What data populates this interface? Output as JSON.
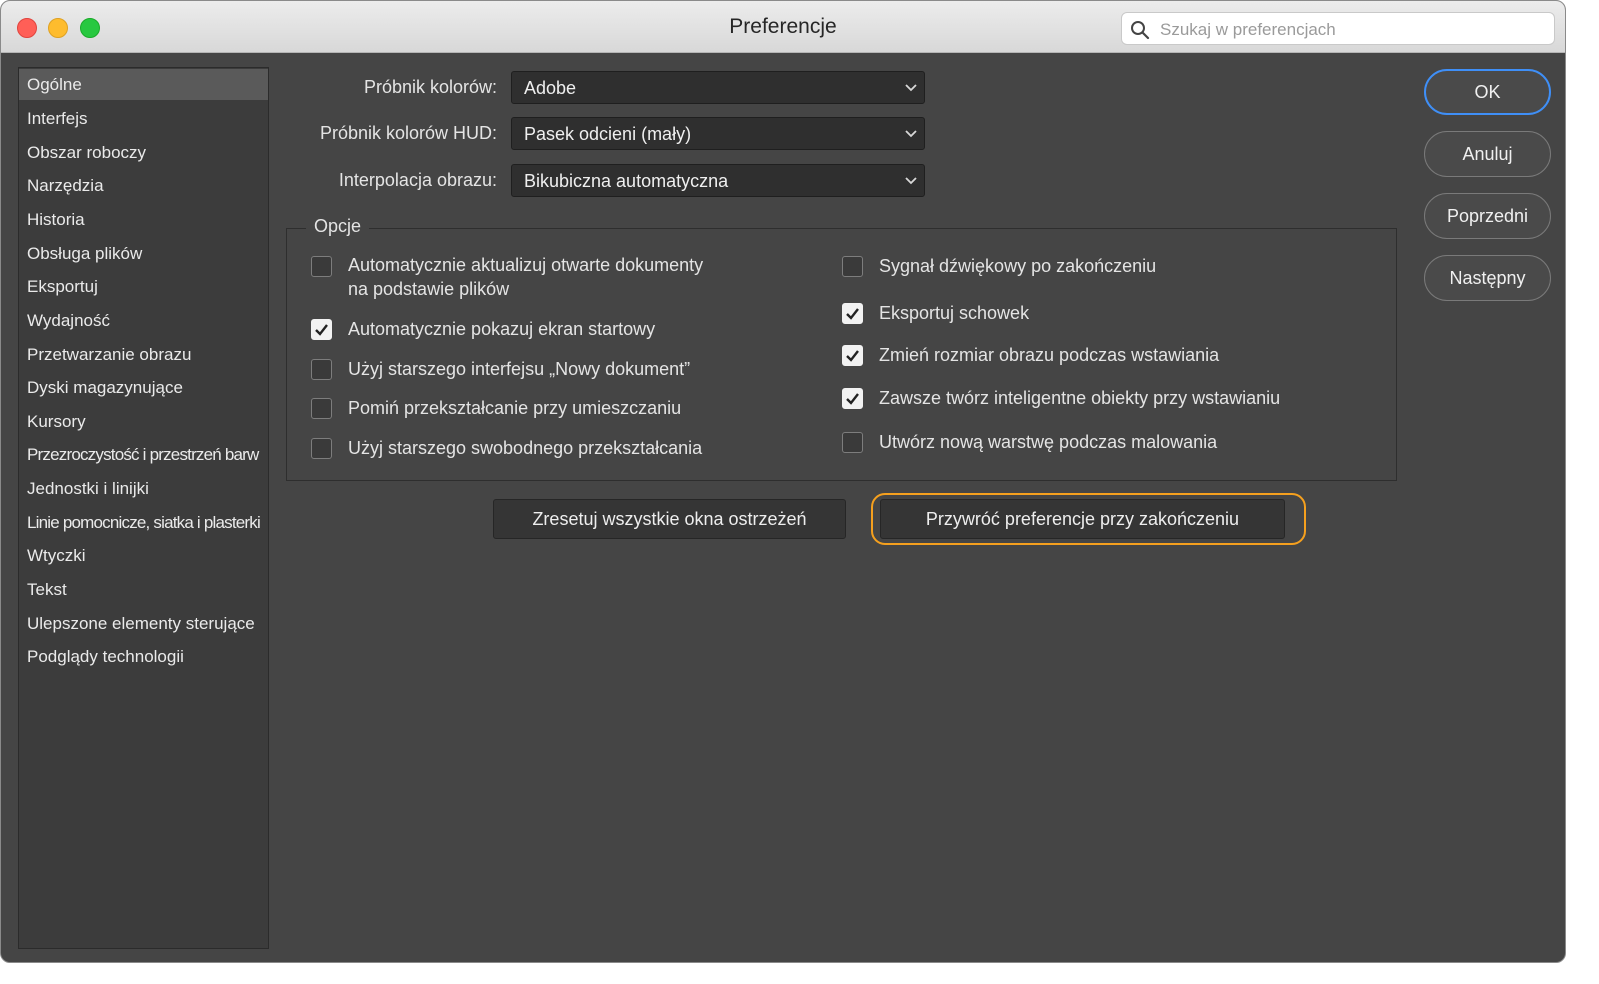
{
  "window": {
    "title": "Preferencje",
    "search": {
      "placeholder": "Szukaj w preferencjach",
      "value": ""
    }
  },
  "sidebar": {
    "items": [
      {
        "label": "Ogólne",
        "active": true
      },
      {
        "label": "Interfejs"
      },
      {
        "label": "Obszar roboczy"
      },
      {
        "label": "Narzędzia"
      },
      {
        "label": "Historia"
      },
      {
        "label": "Obsługa plików"
      },
      {
        "label": "Eksportuj"
      },
      {
        "label": "Wydajność"
      },
      {
        "label": "Przetwarzanie obrazu"
      },
      {
        "label": "Dyski magazynujące"
      },
      {
        "label": "Kursory"
      },
      {
        "label": "Przezroczystość i przestrzeń barw"
      },
      {
        "label": "Jednostki i linijki"
      },
      {
        "label": "Linie pomocnicze, siatka i plasterki"
      },
      {
        "label": "Wtyczki"
      },
      {
        "label": "Tekst"
      },
      {
        "label": "Ulepszone elementy sterujące"
      },
      {
        "label": "Podglądy technologii"
      }
    ]
  },
  "fields": {
    "color_picker": {
      "label": "Próbnik kolorów:",
      "value": "Adobe"
    },
    "hud_color_picker": {
      "label": "Próbnik kolorów HUD:",
      "value": "Pasek odcieni (mały)"
    },
    "image_interpolation": {
      "label": "Interpolacja obrazu:",
      "value": "Bikubiczna automatyczna"
    }
  },
  "options": {
    "title": "Opcje",
    "left": [
      {
        "line1": "Automatycznie aktualizuj otwarte dokumenty",
        "line2": "na podstawie plików",
        "checked": false
      },
      {
        "label": "Automatycznie pokazuj ekran startowy",
        "checked": true
      },
      {
        "label": "Użyj starszego interfejsu „Nowy dokument”",
        "checked": false
      },
      {
        "label": "Pomiń przekształcanie przy umieszczaniu",
        "checked": false
      },
      {
        "label": "Użyj starszego swobodnego przekształcania",
        "checked": false
      }
    ],
    "right": [
      {
        "label": "Sygnał dźwiękowy po zakończeniu",
        "checked": false
      },
      {
        "label": "Eksportuj schowek",
        "checked": true
      },
      {
        "label": "Zmień rozmiar obrazu podczas wstawiania",
        "checked": true
      },
      {
        "label": "Zawsze twórz inteligentne obiekty przy wstawianiu",
        "checked": true
      },
      {
        "label": "Utwórz nową warstwę podczas malowania",
        "checked": false
      }
    ]
  },
  "actions": {
    "reset_warnings": "Zresetuj wszystkie okna ostrzeżeń",
    "reset_prefs": "Przywróć preferencje przy zakończeniu"
  },
  "dialog_buttons": {
    "ok": "OK",
    "cancel": "Anuluj",
    "previous": "Poprzedni",
    "next": "Następny"
  },
  "colors": {
    "window_bg": "#454545",
    "highlight": "#f5a01e",
    "primary_focus": "#3f8ff7"
  }
}
